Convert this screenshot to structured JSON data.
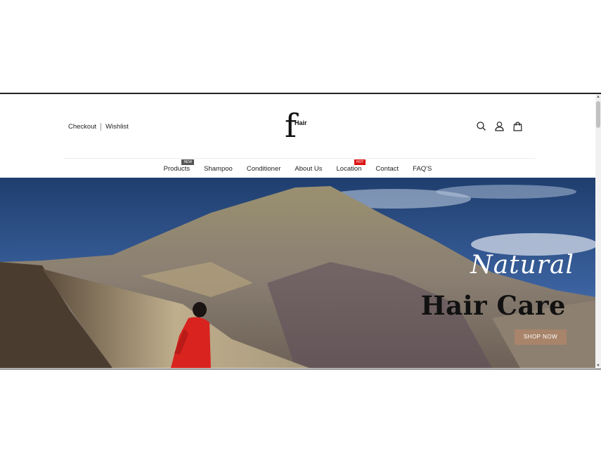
{
  "top_links": {
    "checkout": "Checkout",
    "wishlist": "Wishlist"
  },
  "logo": {
    "letter": "f",
    "word": "Hair"
  },
  "nav": {
    "items": [
      {
        "label": "Products",
        "badge": "NEW"
      },
      {
        "label": "Shampoo"
      },
      {
        "label": "Conditioner"
      },
      {
        "label": "About Us"
      },
      {
        "label": "Location",
        "badge": "HOT"
      },
      {
        "label": "Contact"
      },
      {
        "label": "FAQ'S"
      }
    ]
  },
  "icons": [
    "search-icon",
    "user-icon",
    "cart-bag-icon"
  ],
  "hero": {
    "script_text": "Natural",
    "title": "Hair Care",
    "button_label": "SHOP NOW"
  },
  "colors": {
    "button": "#a8846a",
    "badge_new": "#555555",
    "badge_hot": "#dd1111"
  }
}
